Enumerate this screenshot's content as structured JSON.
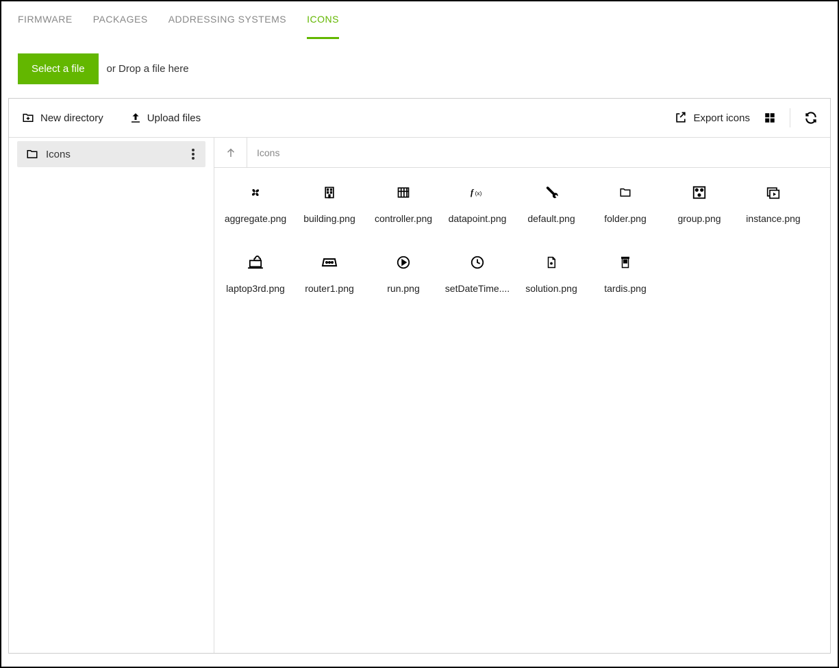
{
  "tabs": [
    {
      "label": "FIRMWARE",
      "active": false
    },
    {
      "label": "PACKAGES",
      "active": false
    },
    {
      "label": "ADDRESSING SYSTEMS",
      "active": false
    },
    {
      "label": "ICONS",
      "active": true
    }
  ],
  "upload": {
    "select_label": "Select a file",
    "drop_hint": "or Drop a file here"
  },
  "toolbar": {
    "new_directory": "New directory",
    "upload_files": "Upload files",
    "export_icons": "Export icons"
  },
  "sidebar": {
    "folder": "Icons"
  },
  "breadcrumb": "Icons",
  "files": [
    {
      "name": "aggregate.png",
      "icon": "fan"
    },
    {
      "name": "building.png",
      "icon": "building"
    },
    {
      "name": "controller.png",
      "icon": "controller"
    },
    {
      "name": "datapoint.png",
      "icon": "function"
    },
    {
      "name": "default.png",
      "icon": "wrench"
    },
    {
      "name": "folder.png",
      "icon": "folder"
    },
    {
      "name": "group.png",
      "icon": "dice"
    },
    {
      "name": "instance.png",
      "icon": "play-frame"
    },
    {
      "name": "laptop3rd.png",
      "icon": "laptop-cloud"
    },
    {
      "name": "router1.png",
      "icon": "router"
    },
    {
      "name": "run.png",
      "icon": "play-circle"
    },
    {
      "name": "setDateTime....",
      "icon": "clock"
    },
    {
      "name": "solution.png",
      "icon": "document"
    },
    {
      "name": "tardis.png",
      "icon": "tardis"
    }
  ]
}
